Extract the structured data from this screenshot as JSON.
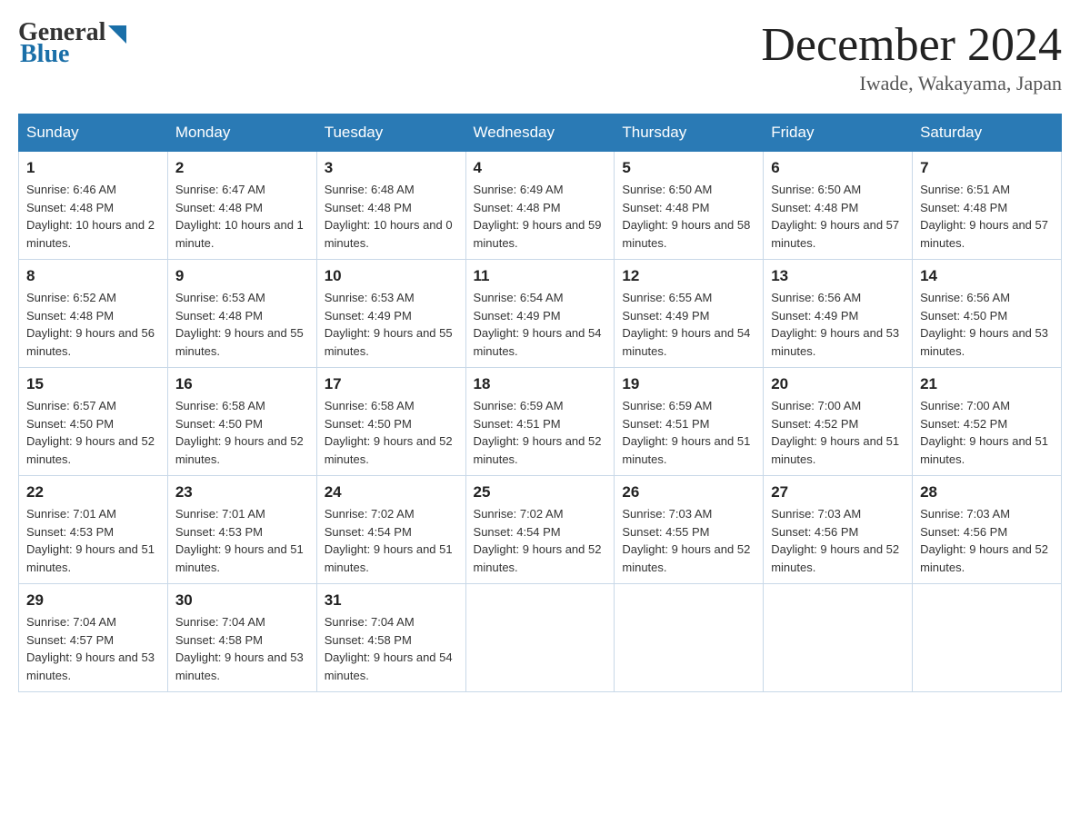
{
  "header": {
    "logo_general": "General",
    "logo_blue": "Blue",
    "month_title": "December 2024",
    "location": "Iwade, Wakayama, Japan"
  },
  "days_of_week": [
    "Sunday",
    "Monday",
    "Tuesday",
    "Wednesday",
    "Thursday",
    "Friday",
    "Saturday"
  ],
  "weeks": [
    [
      {
        "date": "1",
        "sunrise": "6:46 AM",
        "sunset": "4:48 PM",
        "daylight": "10 hours and 2 minutes."
      },
      {
        "date": "2",
        "sunrise": "6:47 AM",
        "sunset": "4:48 PM",
        "daylight": "10 hours and 1 minute."
      },
      {
        "date": "3",
        "sunrise": "6:48 AM",
        "sunset": "4:48 PM",
        "daylight": "10 hours and 0 minutes."
      },
      {
        "date": "4",
        "sunrise": "6:49 AM",
        "sunset": "4:48 PM",
        "daylight": "9 hours and 59 minutes."
      },
      {
        "date": "5",
        "sunrise": "6:50 AM",
        "sunset": "4:48 PM",
        "daylight": "9 hours and 58 minutes."
      },
      {
        "date": "6",
        "sunrise": "6:50 AM",
        "sunset": "4:48 PM",
        "daylight": "9 hours and 57 minutes."
      },
      {
        "date": "7",
        "sunrise": "6:51 AM",
        "sunset": "4:48 PM",
        "daylight": "9 hours and 57 minutes."
      }
    ],
    [
      {
        "date": "8",
        "sunrise": "6:52 AM",
        "sunset": "4:48 PM",
        "daylight": "9 hours and 56 minutes."
      },
      {
        "date": "9",
        "sunrise": "6:53 AM",
        "sunset": "4:48 PM",
        "daylight": "9 hours and 55 minutes."
      },
      {
        "date": "10",
        "sunrise": "6:53 AM",
        "sunset": "4:49 PM",
        "daylight": "9 hours and 55 minutes."
      },
      {
        "date": "11",
        "sunrise": "6:54 AM",
        "sunset": "4:49 PM",
        "daylight": "9 hours and 54 minutes."
      },
      {
        "date": "12",
        "sunrise": "6:55 AM",
        "sunset": "4:49 PM",
        "daylight": "9 hours and 54 minutes."
      },
      {
        "date": "13",
        "sunrise": "6:56 AM",
        "sunset": "4:49 PM",
        "daylight": "9 hours and 53 minutes."
      },
      {
        "date": "14",
        "sunrise": "6:56 AM",
        "sunset": "4:50 PM",
        "daylight": "9 hours and 53 minutes."
      }
    ],
    [
      {
        "date": "15",
        "sunrise": "6:57 AM",
        "sunset": "4:50 PM",
        "daylight": "9 hours and 52 minutes."
      },
      {
        "date": "16",
        "sunrise": "6:58 AM",
        "sunset": "4:50 PM",
        "daylight": "9 hours and 52 minutes."
      },
      {
        "date": "17",
        "sunrise": "6:58 AM",
        "sunset": "4:50 PM",
        "daylight": "9 hours and 52 minutes."
      },
      {
        "date": "18",
        "sunrise": "6:59 AM",
        "sunset": "4:51 PM",
        "daylight": "9 hours and 52 minutes."
      },
      {
        "date": "19",
        "sunrise": "6:59 AM",
        "sunset": "4:51 PM",
        "daylight": "9 hours and 51 minutes."
      },
      {
        "date": "20",
        "sunrise": "7:00 AM",
        "sunset": "4:52 PM",
        "daylight": "9 hours and 51 minutes."
      },
      {
        "date": "21",
        "sunrise": "7:00 AM",
        "sunset": "4:52 PM",
        "daylight": "9 hours and 51 minutes."
      }
    ],
    [
      {
        "date": "22",
        "sunrise": "7:01 AM",
        "sunset": "4:53 PM",
        "daylight": "9 hours and 51 minutes."
      },
      {
        "date": "23",
        "sunrise": "7:01 AM",
        "sunset": "4:53 PM",
        "daylight": "9 hours and 51 minutes."
      },
      {
        "date": "24",
        "sunrise": "7:02 AM",
        "sunset": "4:54 PM",
        "daylight": "9 hours and 51 minutes."
      },
      {
        "date": "25",
        "sunrise": "7:02 AM",
        "sunset": "4:54 PM",
        "daylight": "9 hours and 52 minutes."
      },
      {
        "date": "26",
        "sunrise": "7:03 AM",
        "sunset": "4:55 PM",
        "daylight": "9 hours and 52 minutes."
      },
      {
        "date": "27",
        "sunrise": "7:03 AM",
        "sunset": "4:56 PM",
        "daylight": "9 hours and 52 minutes."
      },
      {
        "date": "28",
        "sunrise": "7:03 AM",
        "sunset": "4:56 PM",
        "daylight": "9 hours and 52 minutes."
      }
    ],
    [
      {
        "date": "29",
        "sunrise": "7:04 AM",
        "sunset": "4:57 PM",
        "daylight": "9 hours and 53 minutes."
      },
      {
        "date": "30",
        "sunrise": "7:04 AM",
        "sunset": "4:58 PM",
        "daylight": "9 hours and 53 minutes."
      },
      {
        "date": "31",
        "sunrise": "7:04 AM",
        "sunset": "4:58 PM",
        "daylight": "9 hours and 54 minutes."
      },
      {
        "date": "",
        "sunrise": "",
        "sunset": "",
        "daylight": ""
      },
      {
        "date": "",
        "sunrise": "",
        "sunset": "",
        "daylight": ""
      },
      {
        "date": "",
        "sunrise": "",
        "sunset": "",
        "daylight": ""
      },
      {
        "date": "",
        "sunrise": "",
        "sunset": "",
        "daylight": ""
      }
    ]
  ]
}
